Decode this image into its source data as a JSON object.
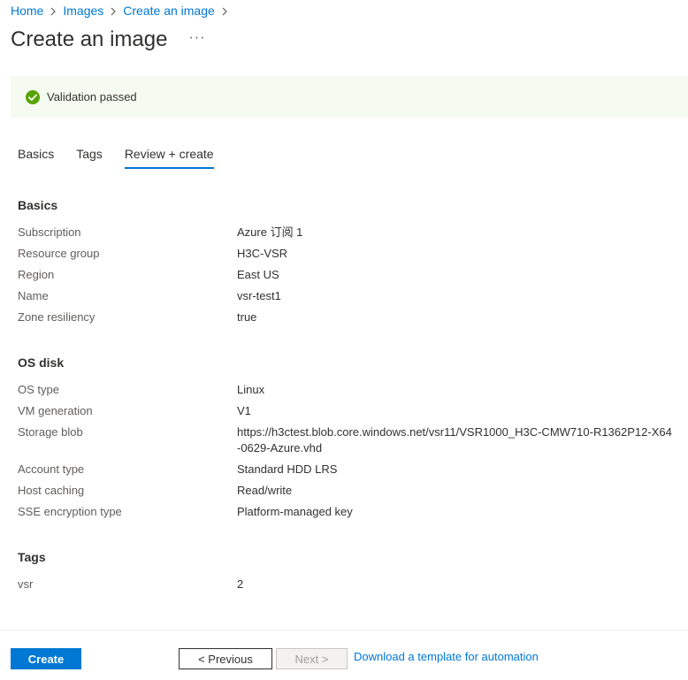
{
  "breadcrumb": {
    "items": [
      "Home",
      "Images",
      "Create an image"
    ]
  },
  "page": {
    "title": "Create an image",
    "more_label": "···"
  },
  "banner": {
    "text": "Validation passed",
    "icon": "check-circle-icon",
    "color": "#57a300",
    "background": "#f6fbf2"
  },
  "tabs": [
    {
      "label": "Basics",
      "active": false
    },
    {
      "label": "Tags",
      "active": false
    },
    {
      "label": "Review + create",
      "active": true
    }
  ],
  "sections": {
    "basics": {
      "title": "Basics",
      "rows": [
        {
          "key": "Subscription",
          "value": "Azure 订阅 1"
        },
        {
          "key": "Resource group",
          "value": "H3C-VSR"
        },
        {
          "key": "Region",
          "value": "East US"
        },
        {
          "key": "Name",
          "value": "vsr-test1"
        },
        {
          "key": "Zone resiliency",
          "value": "true"
        }
      ]
    },
    "os_disk": {
      "title": "OS disk",
      "rows": [
        {
          "key": "OS type",
          "value": "Linux"
        },
        {
          "key": "VM generation",
          "value": "V1"
        },
        {
          "key": "Storage blob",
          "value": "https://h3ctest.blob.core.windows.net/vsr11/VSR1000_H3C-CMW710-R1362P12-X64-0629-Azure.vhd"
        },
        {
          "key": "Account type",
          "value": "Standard HDD LRS"
        },
        {
          "key": "Host caching",
          "value": "Read/write"
        },
        {
          "key": "SSE encryption type",
          "value": "Platform-managed key"
        }
      ]
    },
    "tags": {
      "title": "Tags",
      "rows": [
        {
          "key": "vsr",
          "value": "2"
        }
      ]
    }
  },
  "footer": {
    "create_label": "Create",
    "previous_label": "< Previous",
    "next_label": "Next >",
    "download_link": "Download a template for automation"
  },
  "colors": {
    "accent": "#0078d4",
    "text": "#323130",
    "muted": "#605e5c"
  }
}
